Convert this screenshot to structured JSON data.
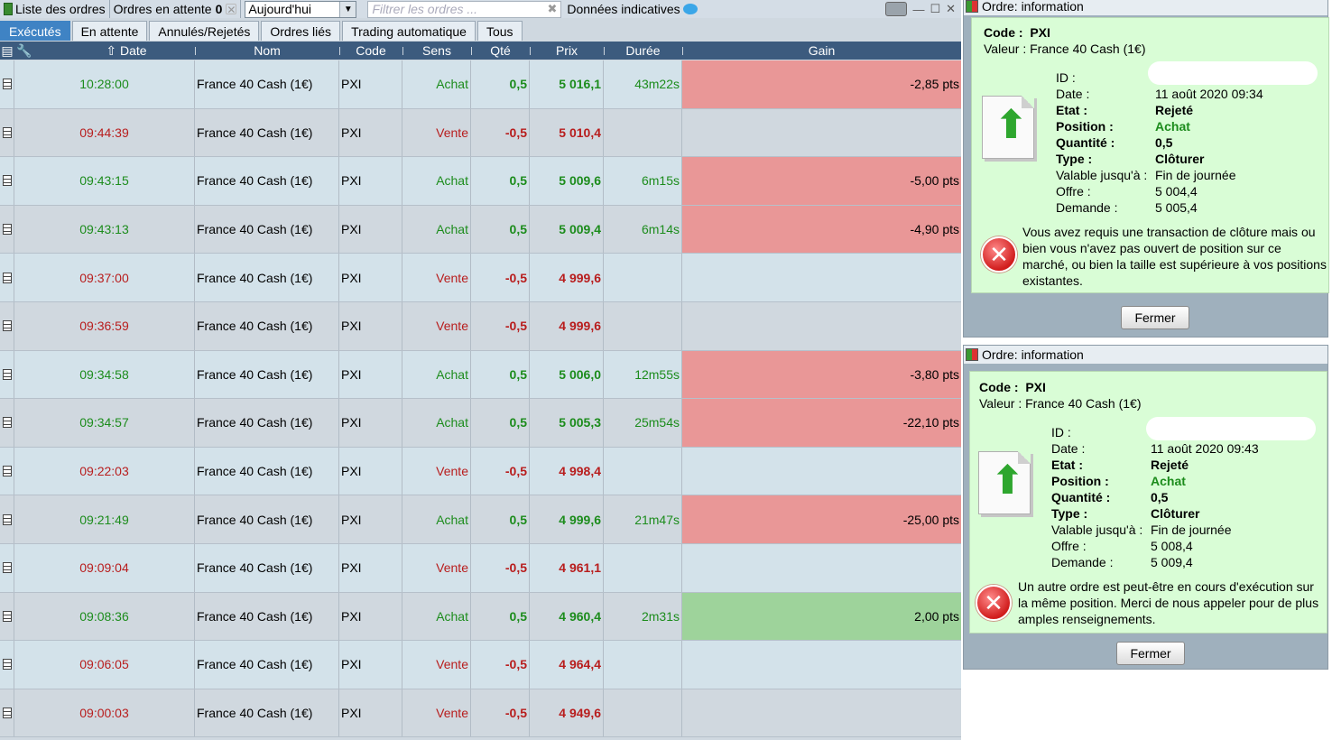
{
  "toolbar": {
    "liste_label": "Liste des ordres",
    "attente_label": "Ordres en attente",
    "attente_count": "0",
    "period_value": "Aujourd'hui",
    "filter_placeholder": "Filtrer les ordres ...",
    "donnees_label": "Données indicatives"
  },
  "tabs": [
    "Exécutés",
    "En attente",
    "Annulés/Rejetés",
    "Ordres liés",
    "Trading automatique",
    "Tous"
  ],
  "active_tab": "Exécutés",
  "columns": {
    "date": "Date",
    "nom": "Nom",
    "code": "Code",
    "sens": "Sens",
    "qte": "Qté",
    "prix": "Prix",
    "duree": "Durée",
    "gain": "Gain"
  },
  "colors": {
    "buy": "#1c8c1c",
    "sell": "#b81d1d",
    "loss_bg": "#e99797",
    "profit_bg": "#9ed39b",
    "header_bg": "#3c5b7e",
    "tab_active": "#3f83c4"
  },
  "rows": [
    {
      "time": "10:28:00",
      "name": "France 40 Cash (1€)",
      "code": "PXI",
      "side": "Achat",
      "qty": "0,5",
      "price": "5 016,1",
      "duration": "43m22s",
      "gain": "-2,85 pts",
      "gain_type": "neg"
    },
    {
      "time": "09:44:39",
      "name": "France 40 Cash (1€)",
      "code": "PXI",
      "side": "Vente",
      "qty": "-0,5",
      "price": "5 010,4",
      "duration": "",
      "gain": "",
      "gain_type": ""
    },
    {
      "time": "09:43:15",
      "name": "France 40 Cash (1€)",
      "code": "PXI",
      "side": "Achat",
      "qty": "0,5",
      "price": "5 009,6",
      "duration": "6m15s",
      "gain": "-5,00 pts",
      "gain_type": "neg"
    },
    {
      "time": "09:43:13",
      "name": "France 40 Cash (1€)",
      "code": "PXI",
      "side": "Achat",
      "qty": "0,5",
      "price": "5 009,4",
      "duration": "6m14s",
      "gain": "-4,90 pts",
      "gain_type": "neg"
    },
    {
      "time": "09:37:00",
      "name": "France 40 Cash (1€)",
      "code": "PXI",
      "side": "Vente",
      "qty": "-0,5",
      "price": "4 999,6",
      "duration": "",
      "gain": "",
      "gain_type": ""
    },
    {
      "time": "09:36:59",
      "name": "France 40 Cash (1€)",
      "code": "PXI",
      "side": "Vente",
      "qty": "-0,5",
      "price": "4 999,6",
      "duration": "",
      "gain": "",
      "gain_type": ""
    },
    {
      "time": "09:34:58",
      "name": "France 40 Cash (1€)",
      "code": "PXI",
      "side": "Achat",
      "qty": "0,5",
      "price": "5 006,0",
      "duration": "12m55s",
      "gain": "-3,80 pts",
      "gain_type": "neg"
    },
    {
      "time": "09:34:57",
      "name": "France 40 Cash (1€)",
      "code": "PXI",
      "side": "Achat",
      "qty": "0,5",
      "price": "5 005,3",
      "duration": "25m54s",
      "gain": "-22,10 pts",
      "gain_type": "neg"
    },
    {
      "time": "09:22:03",
      "name": "France 40 Cash (1€)",
      "code": "PXI",
      "side": "Vente",
      "qty": "-0,5",
      "price": "4 998,4",
      "duration": "",
      "gain": "",
      "gain_type": ""
    },
    {
      "time": "09:21:49",
      "name": "France 40 Cash (1€)",
      "code": "PXI",
      "side": "Achat",
      "qty": "0,5",
      "price": "4 999,6",
      "duration": "21m47s",
      "gain": "-25,00 pts",
      "gain_type": "neg"
    },
    {
      "time": "09:09:04",
      "name": "France 40 Cash (1€)",
      "code": "PXI",
      "side": "Vente",
      "qty": "-0,5",
      "price": "4 961,1",
      "duration": "",
      "gain": "",
      "gain_type": ""
    },
    {
      "time": "09:08:36",
      "name": "France 40 Cash (1€)",
      "code": "PXI",
      "side": "Achat",
      "qty": "0,5",
      "price": "4 960,4",
      "duration": "2m31s",
      "gain": "2,00 pts",
      "gain_type": "pos"
    },
    {
      "time": "09:06:05",
      "name": "France 40 Cash (1€)",
      "code": "PXI",
      "side": "Vente",
      "qty": "-0,5",
      "price": "4 964,4",
      "duration": "",
      "gain": "",
      "gain_type": ""
    },
    {
      "time": "09:00:03",
      "name": "France 40 Cash (1€)",
      "code": "PXI",
      "side": "Vente",
      "qty": "-0,5",
      "price": "4 949,6",
      "duration": "",
      "gain": "",
      "gain_type": ""
    }
  ],
  "dialog1": {
    "title": "Ordre: information",
    "code_label": "Code :",
    "code_value": "PXI",
    "valeur_label": "Valeur :",
    "valeur_value": "France 40 Cash (1€)",
    "id_label": "ID :",
    "date_label": "Date :",
    "date_value": "11 août 2020 09:34",
    "etat_label": "Etat :",
    "etat_value": "Rejeté",
    "position_label": "Position :",
    "position_value": "Achat",
    "quantite_label": "Quantité :",
    "quantite_value": "0,5",
    "type_label": "Type :",
    "type_value": "Clôturer",
    "valable_label": "Valable jusqu'à :",
    "valable_value": "Fin de journée",
    "offre_label": "Offre :",
    "offre_value": "5 004,4",
    "demande_label": "Demande :",
    "demande_value": "5 005,4",
    "message": "Vous avez requis une transaction de clôture mais ou bien vous n'avez pas ouvert de position sur ce marché, ou bien la taille est supérieure à vos positions existantes.",
    "button": "Fermer"
  },
  "dialog2": {
    "title": "Ordre: information",
    "code_label": "Code :",
    "code_value": "PXI",
    "valeur_label": "Valeur :",
    "valeur_value": "France 40 Cash (1€)",
    "id_label": "ID :",
    "date_label": "Date :",
    "date_value": "11 août 2020 09:43",
    "etat_label": "Etat :",
    "etat_value": "Rejeté",
    "position_label": "Position :",
    "position_value": "Achat",
    "quantite_label": "Quantité :",
    "quantite_value": "0,5",
    "type_label": "Type :",
    "type_value": "Clôturer",
    "valable_label": "Valable jusqu'à :",
    "valable_value": "Fin de journée",
    "offre_label": "Offre :",
    "offre_value": "5 008,4",
    "demande_label": "Demande :",
    "demande_value": "5 009,4",
    "message": "Un autre ordre est peut-être en cours d'exécution sur la même position. Merci de nous appeler pour de plus amples renseignements.",
    "button": "Fermer"
  }
}
